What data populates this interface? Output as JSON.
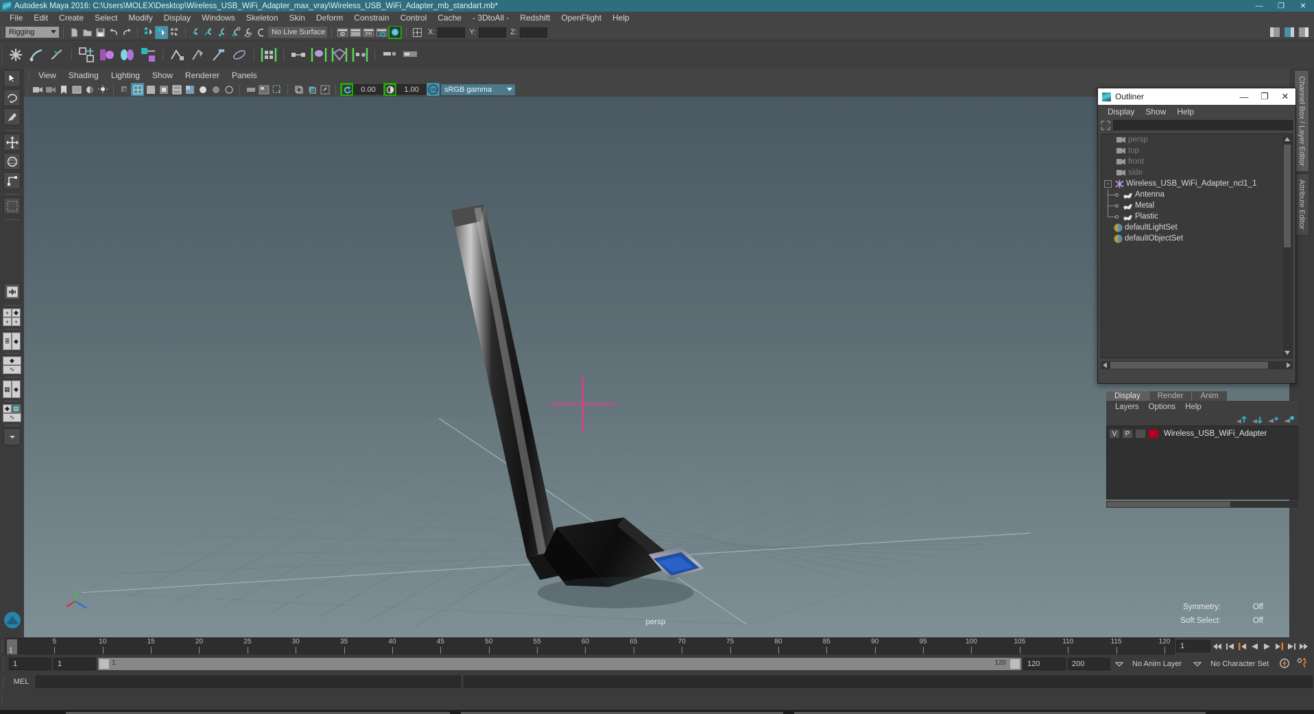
{
  "window": {
    "title": "Autodesk Maya 2016: C:\\Users\\MOLEX\\Desktop\\Wireless_USB_WiFi_Adapter_max_vray\\Wireless_USB_WiFi_Adapter_mb_standart.mb*",
    "minimize": "—",
    "maximize": "❐",
    "close": "✕",
    "logo_icon": "maya-logo-icon"
  },
  "menubar": {
    "items": [
      "File",
      "Edit",
      "Create",
      "Select",
      "Modify",
      "Display",
      "Windows",
      "Skeleton",
      "Skin",
      "Deform",
      "Constrain",
      "Control",
      "Cache",
      "- 3DtoAll -",
      "Redshift",
      "OpenFlight",
      "Help"
    ]
  },
  "statusline": {
    "menuset": "Rigging",
    "live_surface": "No Live Surface",
    "x_label": "X:",
    "y_label": "Y:",
    "z_label": "Z:",
    "x_value": "",
    "y_value": "",
    "z_value": "",
    "ipr_label": "IPR"
  },
  "viewport_panel": {
    "menus": [
      "View",
      "Shading",
      "Lighting",
      "Show",
      "Renderer",
      "Panels"
    ],
    "exposure_value": "0.00",
    "gamma_value": "1.00",
    "color_management_toggle": "ON",
    "color_profile": "sRGB gamma",
    "camera_label": "persp",
    "overlay": [
      {
        "label": "Symmetry:",
        "value": "Off"
      },
      {
        "label": "Soft Select:",
        "value": "Off"
      }
    ]
  },
  "outliner": {
    "title": "Outliner",
    "menus": [
      "Display",
      "Show",
      "Help"
    ],
    "search_placeholder": "",
    "search_value": "",
    "items": [
      {
        "name": "persp",
        "icon": "camera-icon",
        "indent": 1,
        "dim": true
      },
      {
        "name": "top",
        "icon": "camera-icon",
        "indent": 1,
        "dim": true
      },
      {
        "name": "front",
        "icon": "camera-icon",
        "indent": 1,
        "dim": true
      },
      {
        "name": "side",
        "icon": "camera-icon",
        "indent": 1,
        "dim": true
      },
      {
        "name": "Wireless_USB_WiFi_Adapter_ncl1_1",
        "icon": "nucleus-icon",
        "indent": 0,
        "dim": false,
        "expander": "-"
      },
      {
        "name": "Antenna",
        "icon": "ncloth-icon",
        "indent": 2,
        "dim": false
      },
      {
        "name": "Metal",
        "icon": "ncloth-icon",
        "indent": 2,
        "dim": false
      },
      {
        "name": "Plastic",
        "icon": "ncloth-icon",
        "indent": 2,
        "dim": false
      },
      {
        "name": "defaultLightSet",
        "icon": "set-icon",
        "indent": 1,
        "dim": false
      },
      {
        "name": "defaultObjectSet",
        "icon": "set-icon",
        "indent": 1,
        "dim": false
      }
    ]
  },
  "layer_editor": {
    "tabs": [
      "Display",
      "Render",
      "Anim"
    ],
    "selected_tab": "Display",
    "menus": [
      "Layers",
      "Options",
      "Help"
    ],
    "layers": [
      {
        "visibility": "V",
        "playback": "P",
        "shading": "",
        "color": "#b4001e",
        "name": "Wireless_USB_WiFi_Adapter"
      }
    ]
  },
  "timeline": {
    "ticks": [
      5,
      10,
      15,
      20,
      25,
      30,
      35,
      40,
      45,
      50,
      55,
      60,
      65,
      70,
      75,
      80,
      85,
      90,
      95,
      100,
      105,
      110,
      115,
      120
    ],
    "current_frame": "1",
    "range_start": "1",
    "range_end": "120",
    "anim_start": "1",
    "anim_end": "120",
    "playback_end_field": "120",
    "playback_max_field": "200",
    "current_frame_field": "1",
    "anim_layer": "No Anim Layer",
    "character_set": "No Character Set"
  },
  "command_line": {
    "language": "MEL",
    "input_value": "",
    "output_value": ""
  },
  "right_tabs": [
    "Channel Box / Layer Editor",
    "Attribute Editor"
  ],
  "colors": {
    "accent_teal": "#2e6e7e",
    "highlight_blue": "#4a8fa8",
    "layer_red": "#b4001e",
    "playback_orange": "#e07b28",
    "pivot_magenta": "#ff2d8a"
  }
}
